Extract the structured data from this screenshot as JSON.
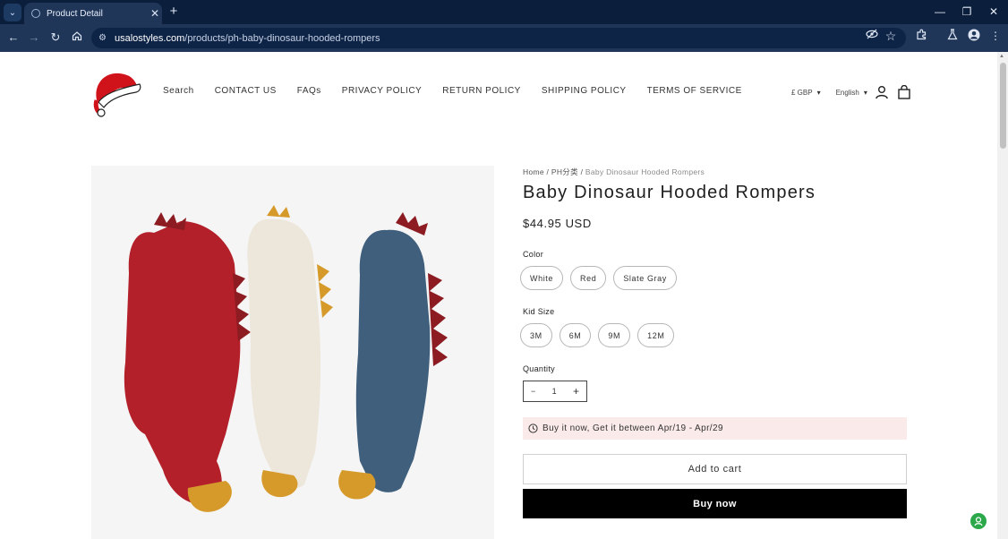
{
  "browser": {
    "tab_title": "Product Detail",
    "url_domain": "usalostyles.com",
    "url_path": "/products/ph-baby-dinosaur-hooded-rompers",
    "new_tab_label": "+",
    "close_tab_label": "✕",
    "icons": [
      "tab-search-icon",
      "back-icon",
      "forward-icon",
      "reload-icon",
      "home-icon",
      "site-info-icon",
      "eye-off-icon",
      "star-icon",
      "extensions-icon",
      "labs-icon",
      "profile-icon",
      "menu-icon",
      "minimize-icon",
      "restore-icon",
      "close-icon"
    ]
  },
  "header": {
    "nav": [
      "Search",
      "CONTACT US",
      "FAQs",
      "PRIVACY POLICY",
      "RETURN POLICY",
      "SHIPPING POLICY",
      "TERMS OF SERVICE"
    ],
    "currency": "£ GBP",
    "language": "English"
  },
  "product": {
    "breadcrumb": {
      "home": "Home",
      "sep": "/",
      "category": "PH分类",
      "current": "Baby Dinosaur Hooded Rompers"
    },
    "title": "Baby Dinosaur Hooded Rompers",
    "price": "$44.95 USD",
    "color_label": "Color",
    "colors": [
      "White",
      "Red",
      "Slate Gray"
    ],
    "size_label": "Kid Size",
    "sizes": [
      "3M",
      "6M",
      "9M",
      "12M"
    ],
    "quantity_label": "Quantity",
    "quantity": "1",
    "minus": "−",
    "plus": "+",
    "delivery_notice": "Buy it now, Get it between Apr/19 - Apr/29",
    "add_to_cart": "Add to cart",
    "buy_now": "Buy now"
  },
  "colors": {
    "chrome_dark": "#0b1e3c",
    "chrome_bar": "#1f3659",
    "notice_bg": "#fbeaea",
    "romper_red": "#b3202a",
    "romper_white": "#ede6da",
    "romper_blue": "#3f5f7c",
    "spike_orange": "#d69a2b",
    "chat_green": "#2aa84a"
  }
}
